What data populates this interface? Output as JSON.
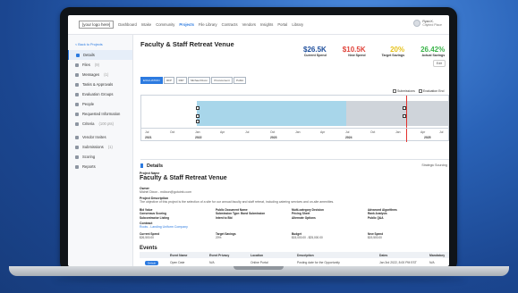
{
  "nav": {
    "logo": "[your logo here]",
    "items": [
      "Dashboard",
      "Intake",
      "Community",
      "Projects",
      "File Library",
      "Contracts",
      "Vendors",
      "Insights",
      "Portal",
      "Library"
    ],
    "active_index": 3,
    "user_name": "Ryan K.",
    "user_org": "Citybird Place"
  },
  "sidebar": {
    "back": "< Back to Projects",
    "items": [
      {
        "label": "Details",
        "count": ""
      },
      {
        "label": "Files",
        "count": "(9)"
      },
      {
        "label": "Messages",
        "count": "(1)"
      },
      {
        "label": "Tasks & Approvals",
        "count": ""
      },
      {
        "label": "Evaluation Groups",
        "count": ""
      },
      {
        "label": "People",
        "count": ""
      },
      {
        "label": "Requested Information",
        "count": ""
      },
      {
        "label": "Criteria",
        "count": "(100 pts)"
      },
      {
        "label": "Vendor Invites",
        "count": ""
      },
      {
        "label": "Submissions",
        "count": "(1)"
      },
      {
        "label": "Scoring",
        "count": ""
      },
      {
        "label": "Reports",
        "count": ""
      }
    ]
  },
  "header": {
    "title": "Faculty & Staff Retreat Venue",
    "more": "Edit",
    "stats": [
      {
        "value": "$26.5K",
        "label": "Current Spend",
        "color": "#1f4f9c"
      },
      {
        "value": "$10.5K",
        "label": "New Spend",
        "color": "#e0433a"
      },
      {
        "value": "20%",
        "label": "Target Savings",
        "color": "#e6c21d"
      },
      {
        "value": "26.42%",
        "label": "Actual Savings",
        "color": "#3bb44a"
      }
    ],
    "tags": [
      "EVALUATION",
      "RFP",
      "RFP",
      "Michael Dixon",
      "Procurement",
      "Public"
    ]
  },
  "timeline": {
    "legend": [
      "Submissions",
      "Evaluation End"
    ],
    "months": [
      "Jul",
      "Oct",
      "Jan",
      "Apr",
      "Jul",
      "Oct",
      "Jan",
      "Apr",
      "Jul",
      "Oct",
      "Jan",
      "Apr",
      "Jul",
      "Oct"
    ],
    "years": [
      "2021",
      "2022",
      "2023",
      "2024",
      "2025"
    ]
  },
  "details": {
    "heading": "Details",
    "strategic": "Strategic Sourcing",
    "project_name_label": "Project Name",
    "project_name": "Faculty & Staff Retreat Venue",
    "owner_label": "Owner",
    "owner": "Michel Dixon - mdixon@gotoinfo.com",
    "description_label": "Project Description",
    "description": "The objective of this project is the selection of a site for our annual faculty and staff retreat, including catering services and on-site amenities.",
    "grid": [
      {
        "label": "Bid Value",
        "value": ""
      },
      {
        "label": "Public Document Name",
        "value": ""
      },
      {
        "label": "Multi-category Decision",
        "value": ""
      },
      {
        "label": "Advanced Algorithms",
        "value": ""
      },
      {
        "label": "Consensus Scoring",
        "value": ""
      },
      {
        "label": "Submission Type: Bond Submission",
        "value": ""
      },
      {
        "label": "Pricing Sheet",
        "value": ""
      },
      {
        "label": "Rank Analysis",
        "value": ""
      },
      {
        "label": "Subcontractor Listing",
        "value": ""
      },
      {
        "label": "Intent to Bid",
        "value": ""
      },
      {
        "label": "Alternate Options",
        "value": ""
      },
      {
        "label": "Public Q&A",
        "value": ""
      }
    ],
    "contract_label": "Contract",
    "contract": "Roots - Landing Uniform Company",
    "bottom": [
      {
        "label": "Current Spend",
        "value": "$26,500.00"
      },
      {
        "label": "Target Savings",
        "value": "20%"
      },
      {
        "label": "Budget",
        "value": "$15,000.00 - $25,000.00"
      },
      {
        "label": "New Spend",
        "value": "$19,500.00"
      }
    ]
  },
  "events": {
    "heading": "Events",
    "columns": [
      "Event Name",
      "Event Privacy",
      "Location",
      "Description",
      "Dates",
      "Mandatory"
    ],
    "row": {
      "tag": "Default",
      "name": "Open Date",
      "privacy": "N/A",
      "location": "Online Portal",
      "description": "Posting date for the Opportunity",
      "date": "Jan 3rd 2022, 8:00 PM EST",
      "mandatory": "N/A"
    }
  }
}
